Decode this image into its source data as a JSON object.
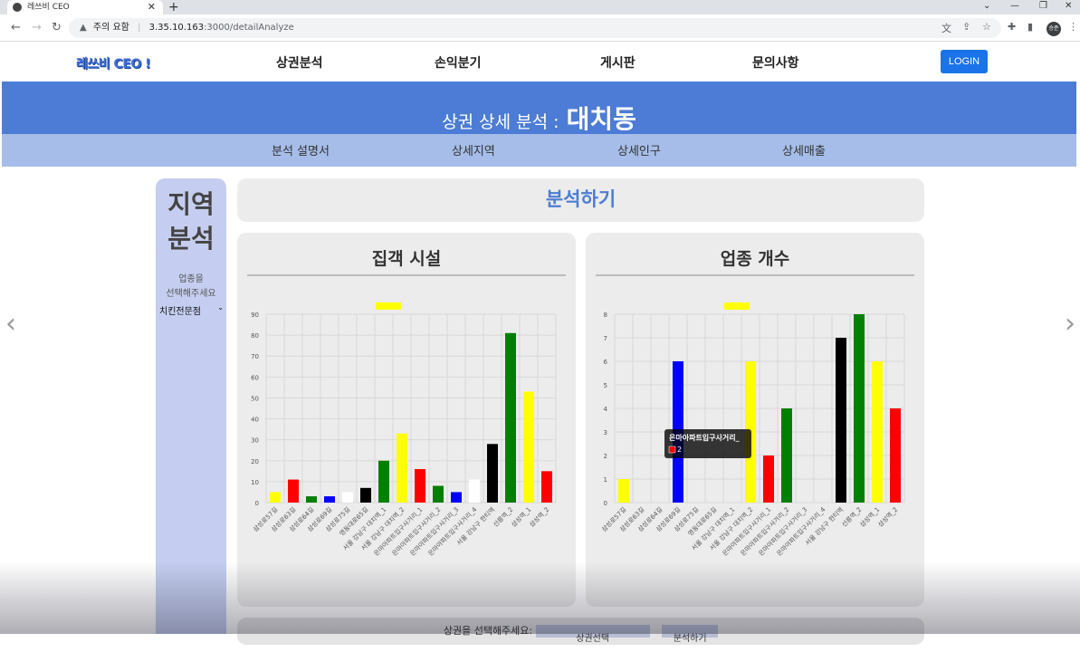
{
  "browser": {
    "tab_title": "레쓰비 CEO",
    "security_label": "주의 요함",
    "url_host": "3.35.10.163",
    "url_path": ":3000/detailAnalyze",
    "profile_initials": "승준"
  },
  "site": {
    "logo": "레쓰비 CEO !",
    "nav": [
      "상권분석",
      "손익분기",
      "게시판",
      "문의사항"
    ],
    "login_label": "LOGIN",
    "banner_label": "상권 상세 분석 :",
    "banner_area": "대치동",
    "subnav": [
      "분석 설명서",
      "상세지역",
      "상세인구",
      "상세매출"
    ]
  },
  "sidebar": {
    "title_line1": "지역",
    "title_line2": "분석",
    "label_line1": "업종을",
    "label_line2": "선택해주세요",
    "selected": "치킨전문점"
  },
  "analyze_header": "분석하기",
  "bottom": {
    "label": "상권을 선택해주세요:",
    "select_value": "상권선택",
    "button": "분석하기"
  },
  "tooltip": {
    "title": "은마아파트입구사거리_",
    "value": "2"
  },
  "colors": {
    "yellow": "#ffff00",
    "red": "#ff0000",
    "green": "#008000",
    "blue": "#0000ff",
    "white": "#ffffff",
    "black": "#000000"
  },
  "chart_data": [
    {
      "type": "bar",
      "title": "집객 시설",
      "ylim": [
        0,
        90
      ],
      "yticks": [
        0,
        10,
        20,
        30,
        40,
        50,
        60,
        70,
        80,
        90
      ],
      "grid": true,
      "categories": [
        "삼성로57길",
        "삼성로63길",
        "삼성로64길",
        "삼성로69길",
        "삼성로75길",
        "영동대로65길",
        "서울 강남구 대치역_1",
        "서울 강남구 대치역_2",
        "은마아파트입구사거리_1",
        "은마아파트입구사거리_2",
        "은마아파트입구사거리_3",
        "은마아파트입구사거리_4",
        "서울 강남구 한티역",
        "선릉역_2",
        "삼성역_1",
        "삼성역_2"
      ],
      "values": [
        5,
        11,
        3,
        3,
        5,
        7,
        20,
        33,
        16,
        8,
        5,
        11,
        28,
        81,
        53,
        15
      ],
      "bar_colors": [
        "yellow",
        "red",
        "green",
        "blue",
        "white",
        "black",
        "green",
        "yellow",
        "red",
        "green",
        "blue",
        "white",
        "black",
        "green",
        "yellow",
        "red"
      ]
    },
    {
      "type": "bar",
      "title": "업종 개수",
      "ylim": [
        0,
        8
      ],
      "yticks": [
        0,
        1,
        2,
        3,
        4,
        5,
        6,
        7,
        8
      ],
      "grid": true,
      "categories": [
        "삼성로57길",
        "삼성로63길",
        "삼성로64길",
        "삼성로69길",
        "삼성로75길",
        "영동대로65길",
        "서울 강남구 대치역_1",
        "서울 강남구 대치역_2",
        "은마아파트입구사거리_1",
        "은마아파트입구사거리_2",
        "은마아파트입구사거리_3",
        "은마아파트입구사거리_4",
        "서울 강남구 한티역",
        "선릉역_2",
        "삼성역_1",
        "삼성역_2"
      ],
      "values": [
        1,
        0,
        0,
        6,
        0,
        0,
        0,
        6,
        2,
        4,
        0,
        0,
        7,
        8,
        6,
        4
      ],
      "bar_colors": [
        "yellow",
        "red",
        "green",
        "blue",
        "white",
        "black",
        "green",
        "yellow",
        "red",
        "green",
        "blue",
        "white",
        "black",
        "green",
        "yellow",
        "red"
      ]
    }
  ]
}
